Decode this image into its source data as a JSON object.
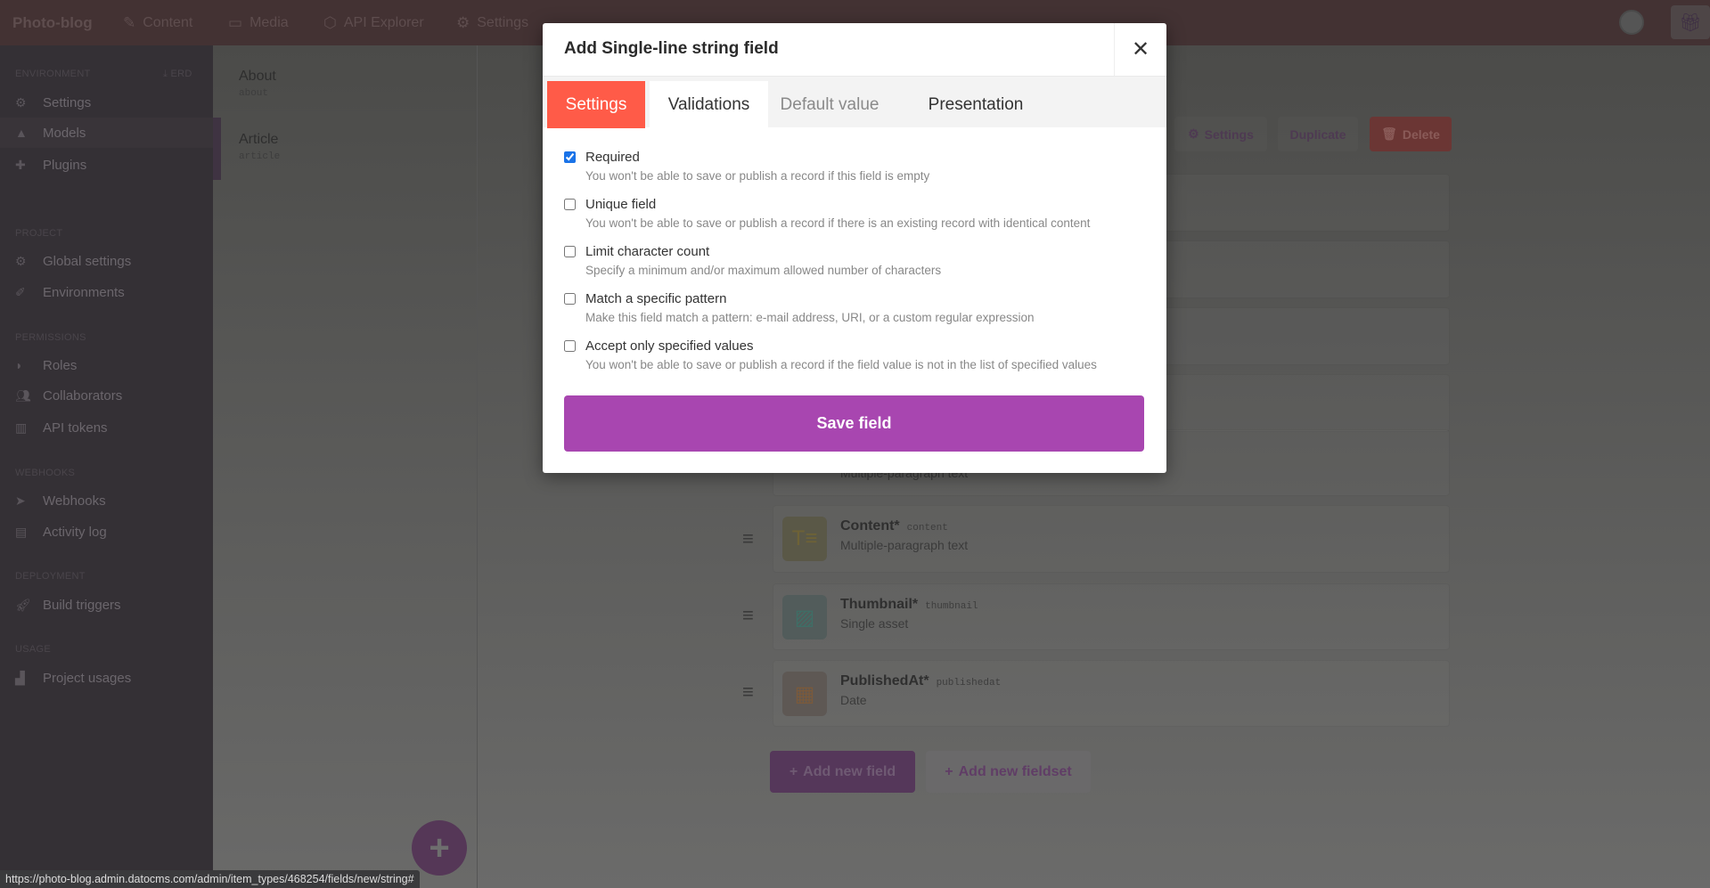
{
  "topbar": {
    "brand": "Photo-blog",
    "nav": [
      {
        "label": "Content",
        "icon": "feather-icon"
      },
      {
        "label": "Media",
        "icon": "image-icon"
      },
      {
        "label": "API Explorer",
        "icon": "graphql-icon"
      },
      {
        "label": "Settings",
        "icon": "gear-icon"
      }
    ]
  },
  "sidebar": {
    "erd": "ERD",
    "sections": [
      {
        "title": "ENVIRONMENT",
        "items": [
          "Settings",
          "Models",
          "Plugins"
        ]
      },
      {
        "title": "PROJECT",
        "items": [
          "Global settings",
          "Environments"
        ]
      },
      {
        "title": "PERMISSIONS",
        "items": [
          "Roles",
          "Collaborators",
          "API tokens"
        ]
      },
      {
        "title": "WEBHOOKS",
        "items": [
          "Webhooks",
          "Activity log"
        ]
      },
      {
        "title": "DEPLOYMENT",
        "items": [
          "Build triggers"
        ]
      },
      {
        "title": "USAGE",
        "items": [
          "Project usages"
        ]
      }
    ]
  },
  "models": [
    {
      "name": "About",
      "api": "about"
    },
    {
      "name": "Article",
      "api": "article"
    }
  ],
  "toolbar": {
    "settings": "Settings",
    "duplicate": "Duplicate",
    "delete": "Delete"
  },
  "fields": [
    {
      "sub": "Multiple-paragraph text"
    },
    {
      "title": "Content*",
      "api": "content",
      "sub": "Multiple-paragraph text"
    },
    {
      "title": "Thumbnail*",
      "api": "thumbnail",
      "sub": "Single asset"
    },
    {
      "title": "PublishedAt*",
      "api": "publishedat",
      "sub": "Date"
    }
  ],
  "actions": {
    "add_field": "Add new field",
    "add_fieldset": "Add new fieldset"
  },
  "modal": {
    "title": "Add Single-line string field",
    "tabs": [
      "Settings",
      "Validations",
      "Default value",
      "Presentation"
    ],
    "active_tab": "Validations",
    "validations": [
      {
        "label": "Required",
        "desc": "You won't be able to save or publish a record if this field is empty",
        "checked": true
      },
      {
        "label": "Unique field",
        "desc": "You won't be able to save or publish a record if there is an existing record with identical content",
        "checked": false
      },
      {
        "label": "Limit character count",
        "desc": "Specify a minimum and/or maximum allowed number of characters",
        "checked": false
      },
      {
        "label": "Match a specific pattern",
        "desc": "Make this field match a pattern: e-mail address, URI, or a custom regular expression",
        "checked": false
      },
      {
        "label": "Accept only specified values",
        "desc": "You won't be able to save or publish a record if the field value is not in the list of specified values",
        "checked": false
      }
    ],
    "save": "Save field"
  },
  "status_url": "https://photo-blog.admin.datocms.com/admin/item_types/468254/fields/new/string#",
  "colors": {
    "accent": "#a846b0",
    "tab_active": "#ff5b48"
  }
}
